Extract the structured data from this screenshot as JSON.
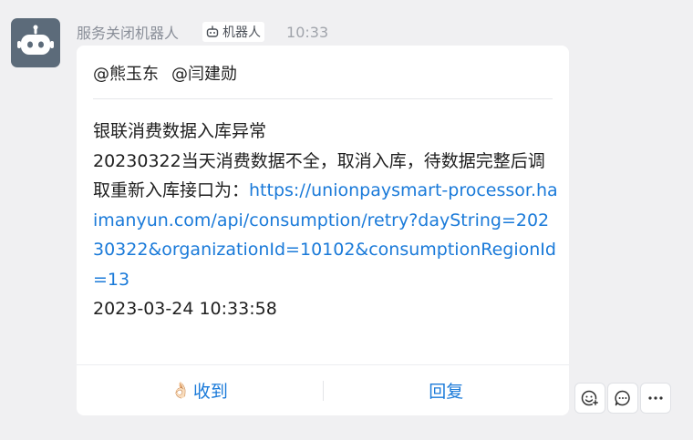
{
  "message": {
    "sender_name": "服务关闭机器人",
    "bot_tag_label": "机器人",
    "time": "10:33",
    "mentions": [
      "@熊玉东",
      "@闫建勋"
    ],
    "title_line": "银联消费数据入库异常",
    "body_prefix": "20230322当天消费数据不全，取消入库，待数据完整后调取重新入库接口为：",
    "link": "https://unionpaysmart-processor.haimanyun.com/api/consumption/retry?dayString=20230322&organizationId=10102&consumptionRegionId=13",
    "timestamp": "2023-03-24 10:33:58"
  },
  "actions": {
    "received_icon": "👌🏻",
    "received_label": "收到",
    "reply_label": "回复"
  },
  "tools": [
    "emoji-reaction-icon",
    "comment-icon",
    "more-icon"
  ],
  "colors": {
    "background": "#f0f0f2",
    "card": "#ffffff",
    "link": "#1a7ad9",
    "avatar": "#5c6b7a"
  }
}
